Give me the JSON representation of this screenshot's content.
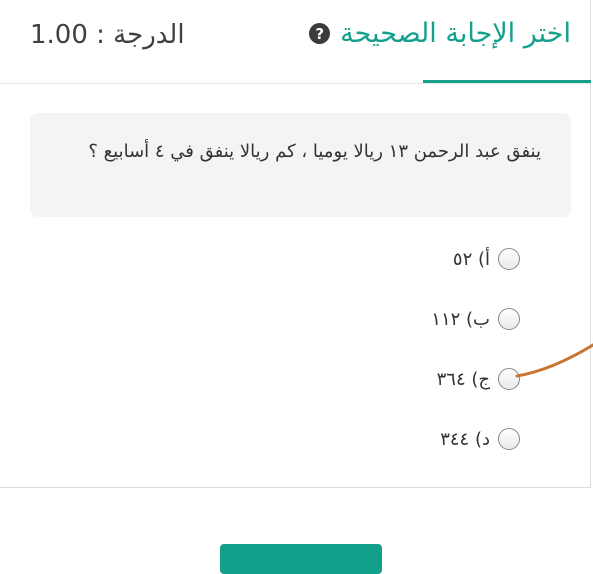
{
  "header": {
    "title": "اختر الإجابة الصحيحة",
    "grade_label": "الدرجة : 1.00",
    "help_icon_glyph": "?"
  },
  "question": {
    "text": "ينفق عبد الرحمن ١٣ ريالا يوميا ، كم ريالا ينفق في ٤ أسابيع ؟"
  },
  "options": [
    {
      "label": "أ) ٥٢"
    },
    {
      "label": "ب) ١١٢"
    },
    {
      "label": "ج) ٣٦٤"
    },
    {
      "label": "د) ٣٤٤"
    }
  ],
  "colors": {
    "accent": "#14a08c",
    "annotation_stroke": "#c8762f"
  }
}
